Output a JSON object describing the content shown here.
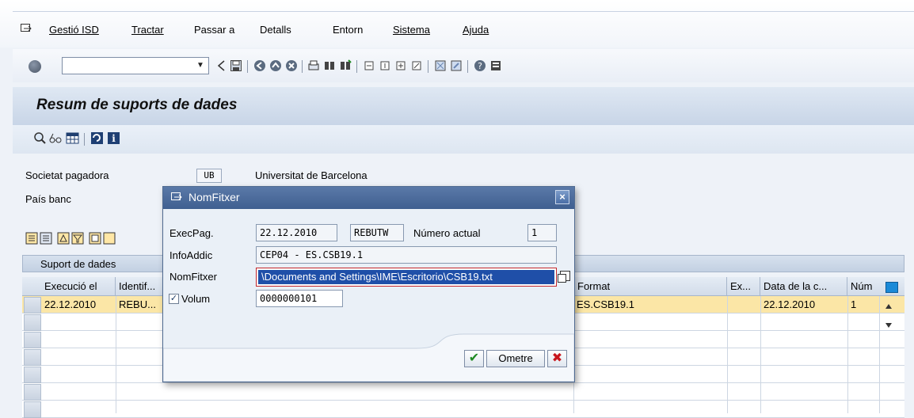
{
  "menu": {
    "items": [
      "Gestió ISD",
      "Tractar",
      "Passar a",
      "Detalls",
      "Entorn",
      "Sistema",
      "Ajuda"
    ]
  },
  "toolbar": {
    "command_value": "",
    "icons": [
      "enter-icon",
      "back-icon",
      "save-icon",
      "back-nav-icon",
      "exit-icon",
      "cancel-icon",
      "print-icon",
      "find-icon",
      "find-next-icon",
      "first-page-icon",
      "prev-page-icon",
      "next-page-icon",
      "last-page-icon",
      "new-session-icon",
      "shortcut-icon",
      "help-icon",
      "layout-menu-icon"
    ]
  },
  "title": "Resum de suports de dades",
  "header_fields": {
    "company_label": "Societat pagadora",
    "company_code": "UB",
    "company_name": "Universitat de Barcelona",
    "country_label": "País banc"
  },
  "grid": {
    "title": "Suport de dades",
    "columns": [
      "Execució el",
      "Identif...",
      "Format",
      "Ex...",
      "Data de la c...",
      "Núm"
    ],
    "rows": [
      {
        "exec": "22.12.2010",
        "ident": "REBU...",
        "format": "ES.CSB19.1",
        "ex": "",
        "date": "22.12.2010",
        "num": "1"
      }
    ]
  },
  "dialog": {
    "title": "NomFitxer",
    "execpag_label": "ExecPag.",
    "execpag_date": "22.12.2010",
    "execpag_id": "REBUTW",
    "current_number_label": "Número actual",
    "current_number": "1",
    "infoaddic_label": "InfoAddic",
    "infoaddic_value": "CEP04 - ES.CSB19.1",
    "filename_label": "NomFitxer",
    "filename_value": "\\Documents and Settings\\IME\\Escritorio\\CSB19.txt",
    "volume_label": "Volum",
    "volume_checked": "✓",
    "volume_value": "0000000101",
    "skip_label": "Ometre",
    "ok_symbol": "✔",
    "cancel_symbol": "✖"
  },
  "colors": {
    "selected_row": "#fbe6a6",
    "dialog_title": "#3f5f90",
    "highlight": "#1f4fa8"
  }
}
